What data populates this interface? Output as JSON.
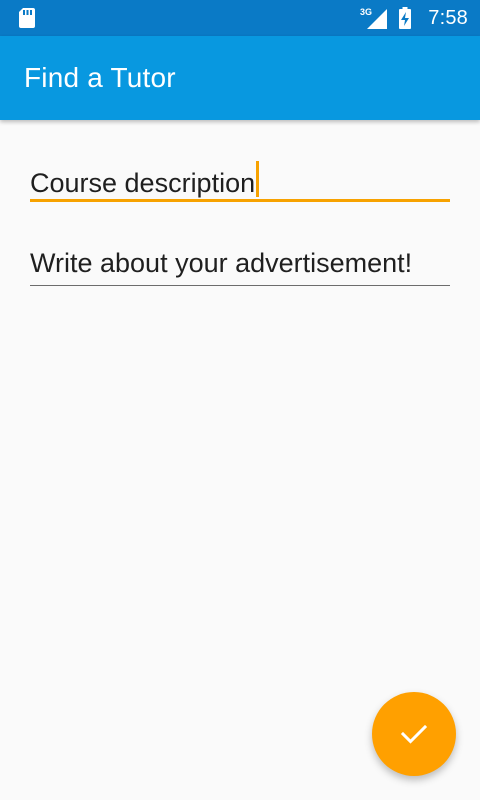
{
  "status_bar": {
    "network_type": "3G",
    "time": "7:58",
    "icons": [
      "sd-card-icon",
      "signal-icon",
      "battery-charging-icon"
    ]
  },
  "app_bar": {
    "title": "Find a Tutor"
  },
  "form": {
    "course_description": {
      "value": "Course description",
      "focused": true
    },
    "advertisement": {
      "placeholder": "Write about your advertisement!",
      "value": ""
    }
  },
  "fab": {
    "icon": "checkmark-icon"
  },
  "colors": {
    "status_bar": "#0a7ac6",
    "app_bar": "#0898e0",
    "accent": "#ffa000",
    "focused_underline": "#f7a200",
    "background": "#fafafa"
  }
}
